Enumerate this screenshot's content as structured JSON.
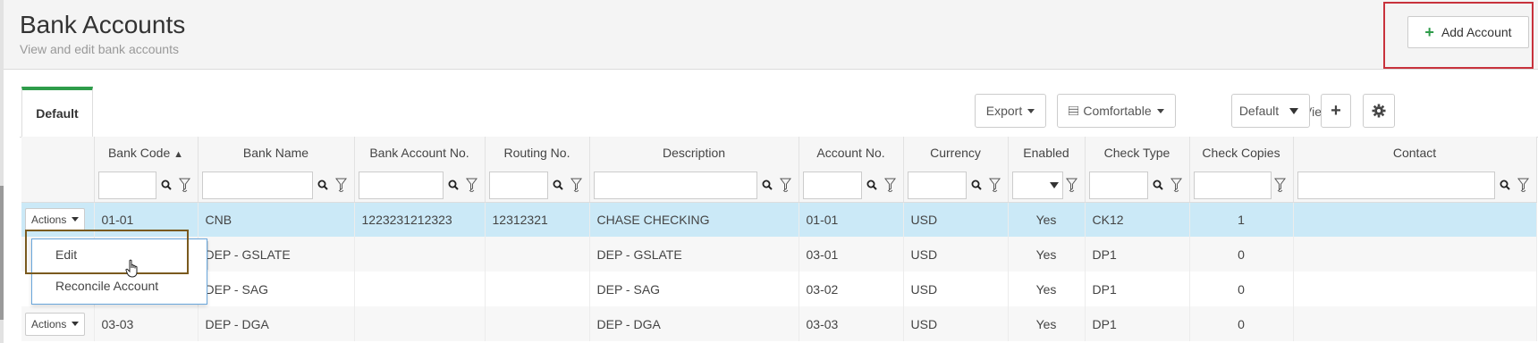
{
  "header": {
    "title": "Bank Accounts",
    "subtitle": "View and edit bank accounts",
    "add_button": "Add Account"
  },
  "tabs": [
    {
      "label": "Default",
      "active": true
    }
  ],
  "toolbar": {
    "export_label": "Export",
    "density_label": "Comfortable",
    "view_label": "View",
    "view_select_value": "Default"
  },
  "grid": {
    "columns": [
      "Bank Code",
      "Bank Name",
      "Bank Account No.",
      "Routing No.",
      "Description",
      "Account No.",
      "Currency",
      "Enabled",
      "Check Type",
      "Check Copies",
      "Contact"
    ],
    "sort": {
      "column": "Bank Code",
      "direction": "asc"
    },
    "actions_label": "Actions",
    "rows": [
      {
        "bank_code": "01-01",
        "bank_name": "CNB",
        "bank_account_no": "1223231212323",
        "routing_no": "12312321",
        "description": "CHASE CHECKING",
        "account_no": "01-01",
        "currency": "USD",
        "enabled": "Yes",
        "check_type": "CK12",
        "check_copies": "1",
        "contact": "",
        "selected": true
      },
      {
        "bank_code": "",
        "bank_name": "DEP - GSLATE",
        "bank_account_no": "",
        "routing_no": "",
        "description": "DEP - GSLATE",
        "account_no": "03-01",
        "currency": "USD",
        "enabled": "Yes",
        "check_type": "DP1",
        "check_copies": "0",
        "contact": ""
      },
      {
        "bank_code": "",
        "bank_name": "DEP - SAG",
        "bank_account_no": "",
        "routing_no": "",
        "description": "DEP - SAG",
        "account_no": "03-02",
        "currency": "USD",
        "enabled": "Yes",
        "check_type": "DP1",
        "check_copies": "0",
        "contact": ""
      },
      {
        "bank_code": "03-03",
        "bank_name": "DEP - DGA",
        "bank_account_no": "",
        "routing_no": "",
        "description": "DEP - DGA",
        "account_no": "03-03",
        "currency": "USD",
        "enabled": "Yes",
        "check_type": "DP1",
        "check_copies": "0",
        "contact": ""
      }
    ]
  },
  "actions_menu": {
    "items": [
      "Edit",
      "Reconcile Account"
    ],
    "highlighted": "Edit"
  },
  "colors": {
    "accent_green": "#2e9c4a",
    "link_blue": "#2b8cc4",
    "selected_row": "#cbe9f7",
    "annotation_red": "#c8323c",
    "annotation_brown": "#7a5a1e"
  }
}
